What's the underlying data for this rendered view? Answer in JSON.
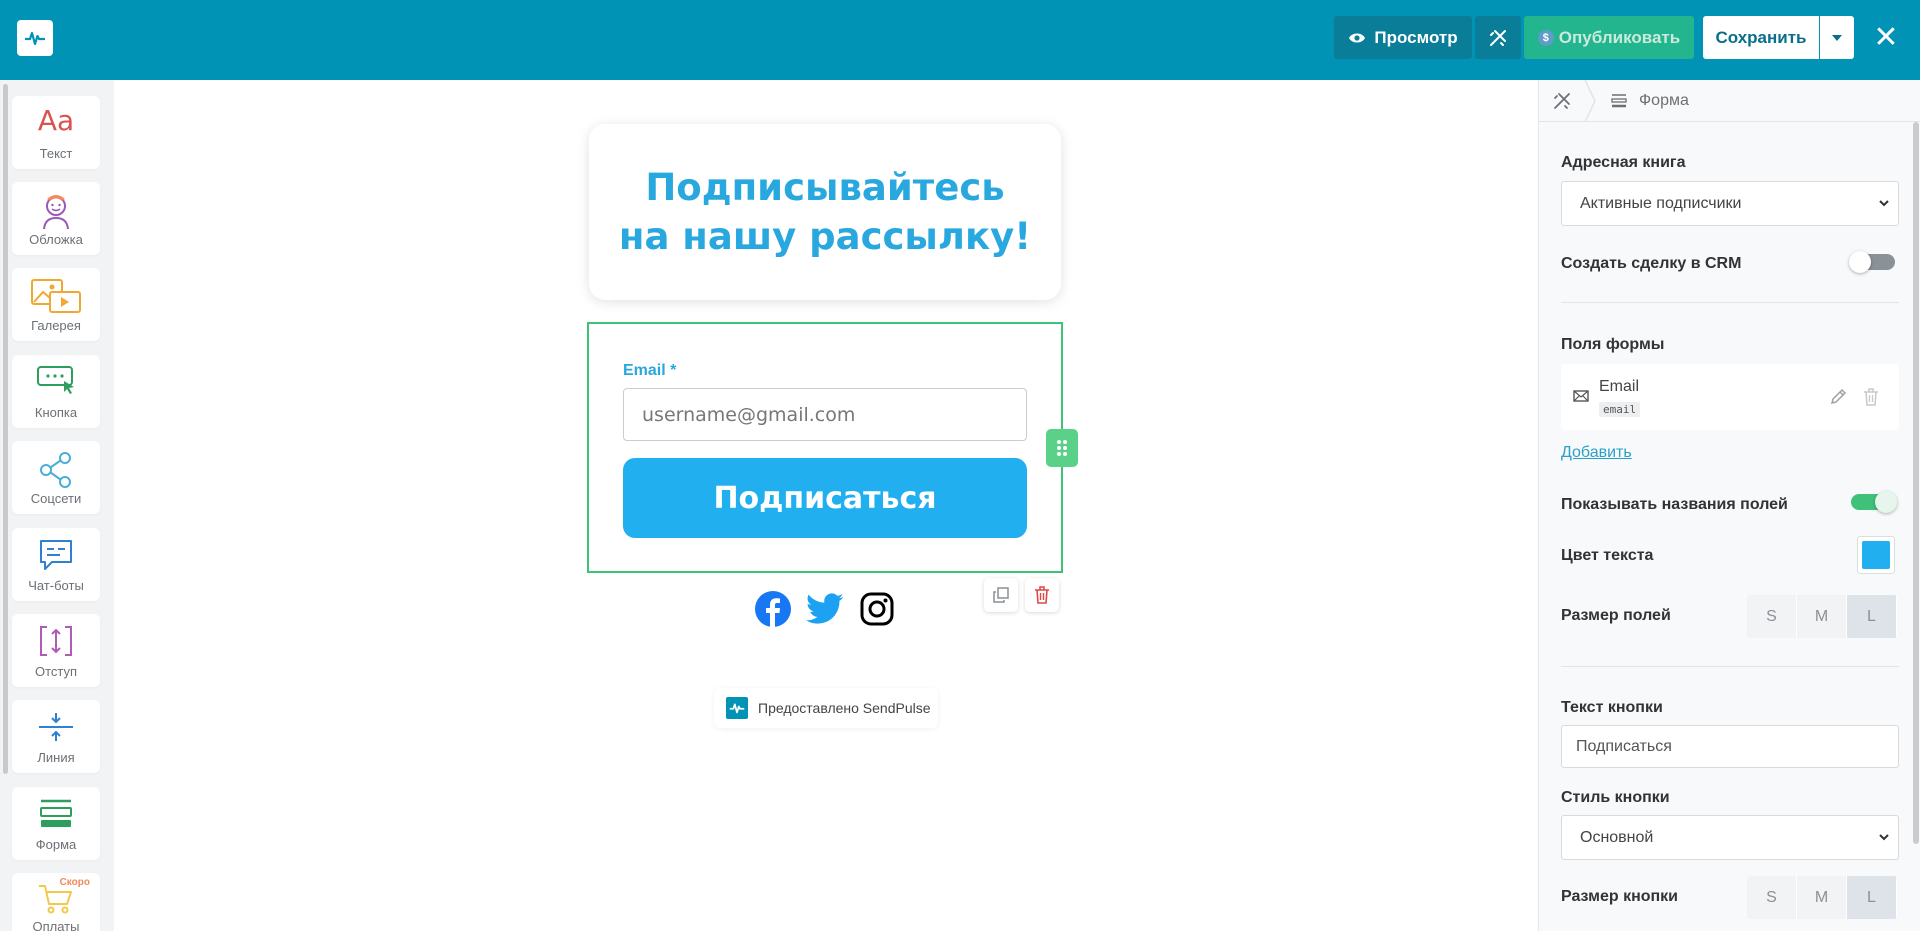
{
  "topbar": {
    "preview_label": "Просмотр",
    "publish_label": "Опубликовать",
    "publish_currency": "$",
    "save_label": "Сохранить",
    "close_symbol": "✕"
  },
  "tools": [
    {
      "label": "Текст",
      "icon": "text-aa-icon",
      "glyph": "Aa"
    },
    {
      "label": "Обложка",
      "icon": "avatar-icon"
    },
    {
      "label": "Галерея",
      "icon": "gallery-icon"
    },
    {
      "label": "Кнопка",
      "icon": "button-icon"
    },
    {
      "label": "Соцсети",
      "icon": "share-icon"
    },
    {
      "label": "Чат-боты",
      "icon": "chat-icon"
    },
    {
      "label": "Отступ",
      "icon": "spacing-icon"
    },
    {
      "label": "Линия",
      "icon": "line-icon"
    },
    {
      "label": "Форма",
      "icon": "form-icon"
    },
    {
      "label": "Оплаты",
      "icon": "cart-icon",
      "badge": "Скоро"
    }
  ],
  "canvas": {
    "title": "Подписывайтесь на нашу рассылку!",
    "email_label": "Email *",
    "email_placeholder": "username@gmail.com",
    "button_label": "Подписаться",
    "powered_by": "Предоставлено SendPulse"
  },
  "panel": {
    "breadcrumb": "Форма",
    "address_book_label": "Адресная книга",
    "address_book_value": "Активные подписчики",
    "crm_label": "Создать сделку в CRM",
    "crm_enabled": false,
    "fields_label": "Поля формы",
    "field_name": "Email",
    "field_key": "email",
    "add_label": "Добавить",
    "show_names_label": "Показывать названия полей",
    "show_names_enabled": true,
    "text_color_label": "Цвет текста",
    "text_color": "#21aff0",
    "field_size_label": "Размер полей",
    "sizes": [
      "S",
      "M",
      "L"
    ],
    "field_size_selected": "L",
    "button_text_label": "Текст кнопки",
    "button_text_value": "Подписаться",
    "button_style_label": "Стиль кнопки",
    "button_style_value": "Основной",
    "button_size_label": "Размер кнопки",
    "button_size_selected": "L"
  },
  "colors": {
    "topbar": "#0093b6",
    "accent": "#29a8e0",
    "button": "#21aff0",
    "selection": "#3ec27a",
    "publish": "#23b58d"
  }
}
